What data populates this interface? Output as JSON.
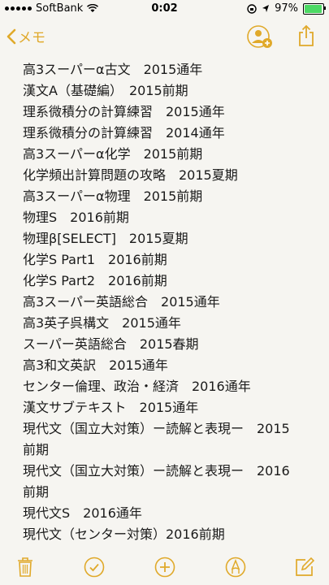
{
  "status_bar": {
    "carrier": "SoftBank",
    "time": "0:02",
    "battery_percent": "97%",
    "battery_level": 0.97
  },
  "nav": {
    "back_label": "メモ"
  },
  "note": {
    "lines": [
      "高3スーパーα古文　2015通年",
      "漢文A（基礎編）　2015前期",
      "理系微積分の計算練習　2015通年",
      "理系微積分の計算練習　2014通年",
      "高3スーパーα化学　2015前期",
      "化学頻出計算問題の攻略　2015夏期",
      "高3スーパーα物理　2015前期",
      "物理S　2016前期",
      "物理β[SELECT]　2015夏期",
      "化学S Part1　2016前期",
      "化学S Part2　2016前期",
      "高3スーパー英語総合　2015通年",
      "高3英子呉構文　2015通年",
      "スーパー英語総合　2015春期",
      "高3和文英訳　2015通年",
      "センター倫理、政治・経済　2016通年",
      "漢文サブテキスト　2015通年",
      "現代文（国立大対策）ー読解と表現ー　2015",
      "前期",
      "現代文（国立大対策）ー読解と表現ー　2016",
      "前期",
      "現代文S　2016通年",
      "現代文（センター対策）2016前期"
    ]
  },
  "colors": {
    "accent": "#e0a92a",
    "background": "#f6f5f1",
    "battery_green": "#4cd964"
  }
}
